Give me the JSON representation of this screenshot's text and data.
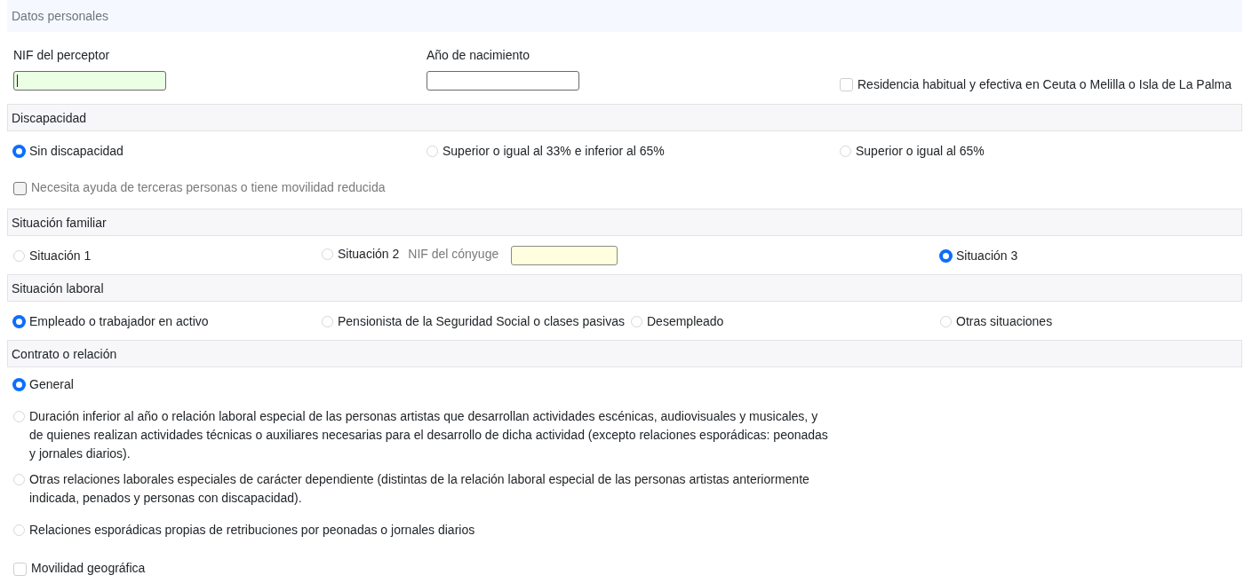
{
  "title": "Datos personales",
  "personal": {
    "fields": [
      {
        "label": "NIF del perceptor",
        "kind": "valid",
        "focused": true
      },
      {
        "label": "Año de nacimiento",
        "kind": "plain",
        "focused": false
      }
    ],
    "residence": {
      "label": "Residencia habitual y efectiva en Ceuta o Melilla o Isla de La Palma",
      "checked": false
    }
  },
  "sections": [
    {
      "title": "Discapacidad",
      "rows": [
        {
          "kind": "thirds",
          "items": [
            {
              "kind": "radio",
              "label": "Sin discapacidad",
              "selected": true
            },
            {
              "kind": "radio",
              "label": "Superior o igual al 33% e inferior al 65%",
              "selected": false
            },
            {
              "kind": "radio",
              "label": "Superior o igual al 65%",
              "selected": false
            }
          ]
        },
        {
          "kind": "full",
          "items": [
            {
              "kind": "checkbox",
              "label": "Necesita ayuda de terceras personas o tiene movilidad reducida",
              "checked": false,
              "disabled": true
            }
          ]
        }
      ]
    },
    {
      "title": "Situación familiar",
      "rows": [
        {
          "kind": "familiar",
          "items": [
            {
              "kind": "radio",
              "label": "Situación 1",
              "selected": false
            },
            {
              "kind": "radio-field",
              "label": "Situación 2",
              "selected": false,
              "field": {
                "label": "NIF del cónyuge",
                "kind": "pending",
                "disabled": true
              }
            },
            {
              "kind": "radio",
              "label": "Situación 3",
              "selected": true
            }
          ]
        }
      ]
    },
    {
      "title": "Situación laboral",
      "rows": [
        {
          "kind": "quarters",
          "items": [
            {
              "kind": "radio",
              "label": "Empleado o trabajador en activo",
              "selected": true
            },
            {
              "kind": "radio",
              "label": "Pensionista de la Seguridad Social o clases pasivas",
              "selected": false
            },
            {
              "kind": "radio",
              "label": "Desempleado",
              "selected": false
            },
            {
              "kind": "radio",
              "label": "Otras situaciones",
              "selected": false
            }
          ]
        }
      ]
    },
    {
      "title": "Contrato o relación",
      "rows": [
        {
          "kind": "full",
          "items": [
            {
              "kind": "radio",
              "label": "General",
              "selected": true
            }
          ]
        },
        {
          "kind": "full",
          "items": [
            {
              "kind": "radio",
              "label": "Duración inferior al año o relación laboral especial de las personas artistas que desarrollan actividades escénicas, audiovisuales y musicales, y de quienes realizan actividades técnicas o auxiliares necesarias para el desarrollo de dicha actividad (excepto relaciones esporádicas: peonadas y jornales diarios).",
              "selected": false
            }
          ]
        },
        {
          "kind": "full",
          "items": [
            {
              "kind": "radio",
              "label": "Otras relaciones laborales especiales de carácter dependiente (distintas de la relación laboral especial de las personas artistas anteriormente indicada, penados y personas con discapacidad).",
              "selected": false
            }
          ]
        },
        {
          "kind": "full",
          "items": [
            {
              "kind": "radio",
              "label": "Relaciones esporádicas propias de retribuciones por peonadas o jornales diarios",
              "selected": false
            }
          ]
        },
        {
          "kind": "full",
          "items": [
            {
              "kind": "checkbox",
              "label": "Movilidad geográfica",
              "checked": false,
              "disabled": false
            }
          ]
        }
      ]
    }
  ]
}
